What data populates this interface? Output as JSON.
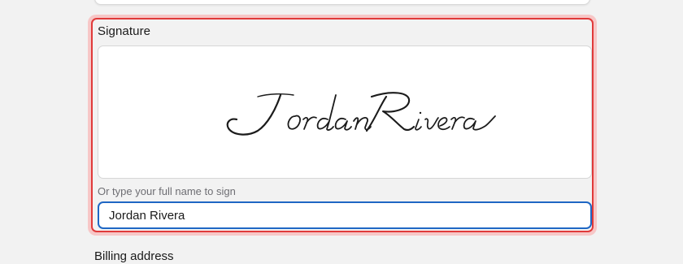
{
  "signature_section": {
    "label": "Signature",
    "signature_image_name": "Jordan Rivera",
    "helper_text": "Or type your full name to sign",
    "typed_name_value": "Jordan Rivera"
  },
  "next_section": {
    "label": "Billing address"
  },
  "colors": {
    "highlight_border": "#e03a3a",
    "highlight_glow": "#f4b6b6",
    "input_focus_border": "#1f67c4"
  }
}
